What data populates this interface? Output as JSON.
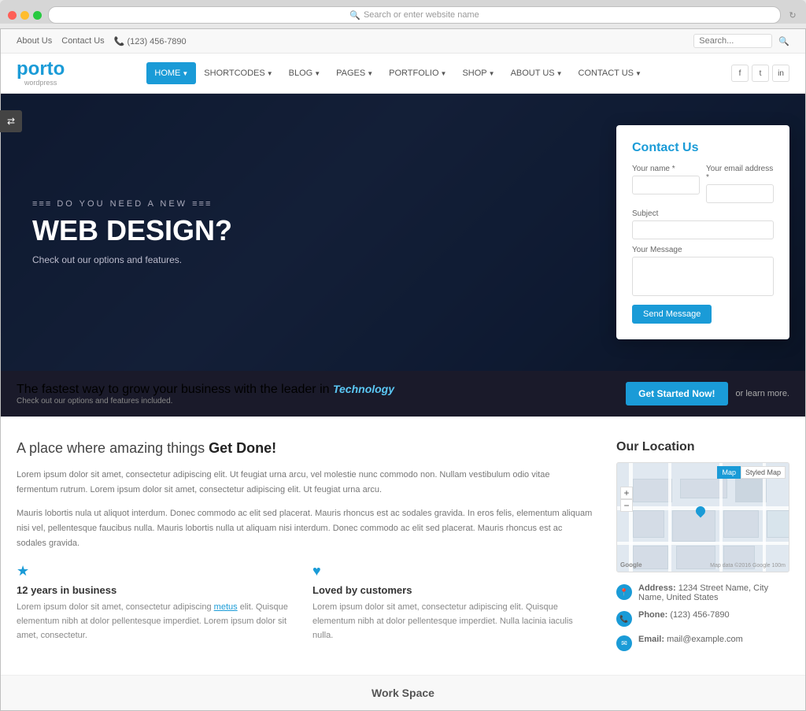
{
  "browser": {
    "address": "Search or enter website name"
  },
  "topbar": {
    "about": "About Us",
    "contact": "Contact Us",
    "phone": "(123) 456-7890",
    "search_placeholder": "Search..."
  },
  "logo": {
    "name": "porto",
    "subtitle": "wordpress"
  },
  "nav": {
    "items": [
      {
        "label": "HOME",
        "active": true,
        "has_arrow": true
      },
      {
        "label": "SHORTCODES",
        "active": false,
        "has_arrow": true
      },
      {
        "label": "BLOG",
        "active": false,
        "has_arrow": true
      },
      {
        "label": "PAGES",
        "active": false,
        "has_arrow": true
      },
      {
        "label": "PORTFOLIO",
        "active": false,
        "has_arrow": true
      },
      {
        "label": "SHOP",
        "active": false,
        "has_arrow": true
      },
      {
        "label": "ABOUT US",
        "active": false,
        "has_arrow": true
      },
      {
        "label": "CONTACT US",
        "active": false,
        "has_arrow": true
      }
    ],
    "social": [
      "f",
      "t",
      "in"
    ]
  },
  "hero": {
    "subtitle": "DO YOU NEED A NEW",
    "title": "WEB DESIGN?",
    "desc": "Check out our options and features."
  },
  "contact_form": {
    "title": "Contact",
    "title_highlight": "Us",
    "name_label": "Your name *",
    "email_label": "Your email address *",
    "subject_label": "Subject",
    "message_label": "Your Message",
    "send_btn": "Send Message"
  },
  "cta": {
    "text": "The fastest way to grow your business with the leader in",
    "highlight": "Technology",
    "sub": "Check out our options and features included.",
    "btn": "Get Started Now!",
    "learn": "or learn more."
  },
  "main": {
    "title": "A place where amazing things",
    "title_bold": "Get Done!",
    "para1": "Lorem ipsum dolor sit amet, consectetur adipiscing elit. Ut feugiat urna arcu, vel molestie nunc commodo non. Nullam vestibulum odio vitae fermentum rutrum. Lorem ipsum dolor sit amet, consectetur adipiscing elit. Ut feugiat urna arcu.",
    "para2": "Mauris lobortis nula ut aliquot interdum. Donec commodo ac elit sed placerat. Mauris rhoncus est ac sodales gravida. In eros felis, elementum aliquam nisi vel, pellentesque faucibus nulla. Mauris lobortis nulla ut aliquam nisi interdum. Donec commodo ac elit sed placerat. Mauris rhoncus est ac sodales gravida.",
    "features": [
      {
        "icon": "★",
        "icon_type": "star",
        "title": "12 years in business",
        "desc": "Lorem ipsum dolor sit amet, consectetur adipiscing metus elit. Quisque elementum nibh at dolor pellentesque imperdiet. Lorem ipsum dolor sit amet, consectetur."
      },
      {
        "icon": "♥",
        "icon_type": "heart",
        "title": "Loved by customers",
        "desc": "Lorem ipsum dolor sit amet, consectetur adipiscing elit. Quisque elementum nibh at dolor pellentesque imperdiet. Nulla lacinia iaculis nulla."
      }
    ]
  },
  "location": {
    "title": "Our Location",
    "map_tab_map": "Map",
    "map_tab_styled": "Styled Map",
    "address_label": "Address:",
    "address_value": "1234 Street Name, City Name, United States",
    "phone_label": "Phone:",
    "phone_value": "(123) 456-7890",
    "email_label": "Email:",
    "email_value": "mail@example.com"
  },
  "work_space": {
    "label": "Work Space"
  }
}
